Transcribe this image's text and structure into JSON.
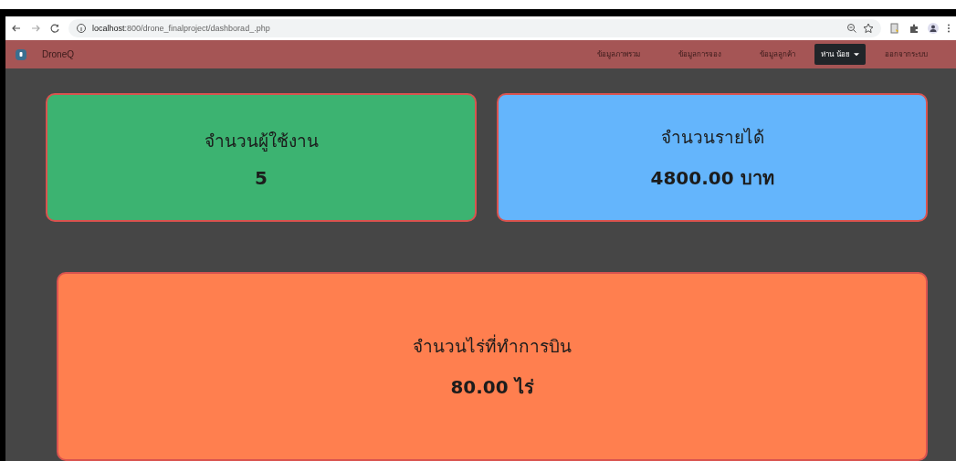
{
  "browser": {
    "url_host": "localhost",
    "url_rest": ":800/drone_finalproject/dashborad_.php"
  },
  "navbar": {
    "brand": "DroneQ",
    "items": [
      {
        "label": "ข้อมูลภาพรวม",
        "kind": "link"
      },
      {
        "label": "ข้อมูลการจอง",
        "kind": "link"
      },
      {
        "label": "ข้อมูลลูกค้า",
        "kind": "link"
      },
      {
        "label": "ห่าน น้อย",
        "kind": "dropdown"
      },
      {
        "label": "ออกจากระบบ",
        "kind": "link"
      }
    ]
  },
  "cards": [
    {
      "title": "จำนวนผู้ใช้งาน",
      "value": "5",
      "color": "#3cb371"
    },
    {
      "title": "จำนวนรายได้",
      "value": "4800.00 บาท",
      "color": "#64b5fc"
    },
    {
      "title": "จำนวนไร่ที่ทำการบิน",
      "value": "80.00 ไร่",
      "color": "#ff7f4f"
    }
  ]
}
